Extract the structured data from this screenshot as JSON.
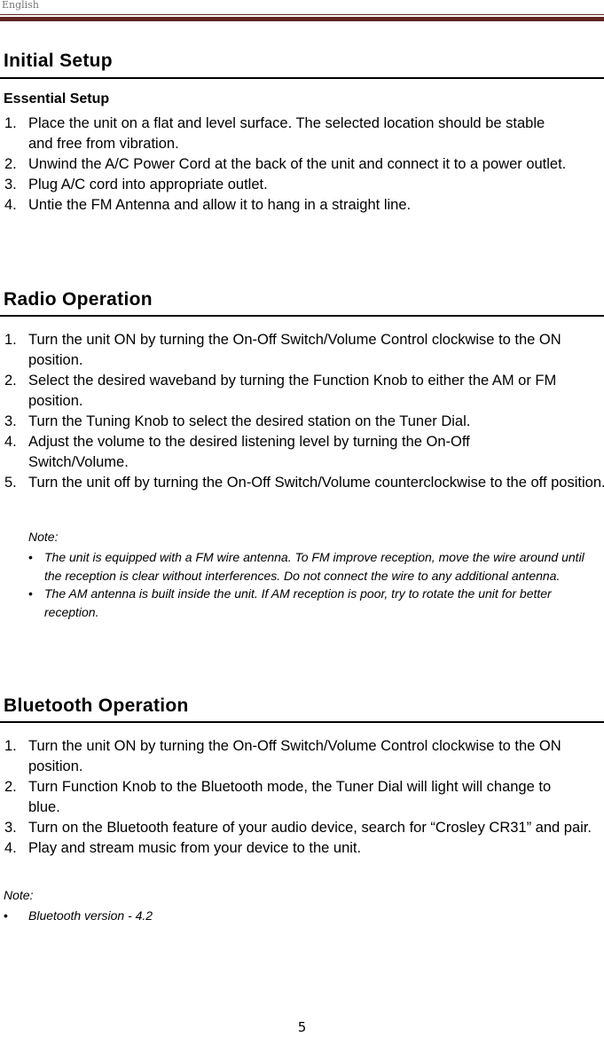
{
  "header": {
    "language": "English",
    "accent_color": "#622423"
  },
  "sections": {
    "initial_setup": {
      "title": "Initial Setup",
      "subtitle": "Essential Setup",
      "steps": [
        {
          "num": "1.",
          "text": "Place the unit on a flat and level surface. The selected location should be stable and free from vibration."
        },
        {
          "num": "2.",
          "text": "Unwind the A/C Power Cord at the back of the unit and connect it to a power outlet."
        },
        {
          "num": "3.",
          "text": "Plug A/C cord into appropriate outlet."
        },
        {
          "num": "4.",
          "text": "Untie the FM Antenna and allow it to hang in a straight line."
        }
      ]
    },
    "radio_operation": {
      "title": "Radio Operation",
      "steps": [
        {
          "num": "1.",
          "text": "Turn the unit ON by turning the On-Off Switch/Volume Control clockwise to the ON position."
        },
        {
          "num": "2.",
          "text": "Select the desired waveband by turning the Function Knob to either the AM or FM position."
        },
        {
          "num": "3.",
          "text": "Turn the Tuning Knob to select the desired station on the Tuner Dial."
        },
        {
          "num": "4.",
          "text": "Adjust the volume to the desired listening level by turning the On-Off Switch/Volume."
        },
        {
          "num": "5.",
          "text": "Turn the unit off by turning the On-Off Switch/Volume counterclockwise to the off position."
        }
      ],
      "note_label": "Note:",
      "notes": [
        "The unit is equipped with a FM wire antenna. To FM improve reception, move the wire around until the reception is clear without interferences. Do not connect the wire to any additional antenna.",
        "The AM antenna is built inside the unit. If AM reception is poor, try to rotate the unit for better reception."
      ]
    },
    "bluetooth_operation": {
      "title": "Bluetooth Operation",
      "steps": [
        {
          "num": "1.",
          "text": "Turn the unit ON by turning the On-Off Switch/Volume Control clockwise to the ON position."
        },
        {
          "num": "2.",
          "text": "Turn Function Knob to the Bluetooth mode, the Tuner Dial will light will change to blue."
        },
        {
          "num": "3.",
          "text": "Turn on the Bluetooth feature of your audio device, search for “Crosley CR31” and pair."
        },
        {
          "num": "4.",
          "text": "Play and stream music from your device to the unit."
        }
      ],
      "note_label": "Note:",
      "notes": [
        "Bluetooth version - 4.2"
      ]
    }
  },
  "footer": {
    "page_number": "5",
    "bullet_glyph": "•"
  }
}
